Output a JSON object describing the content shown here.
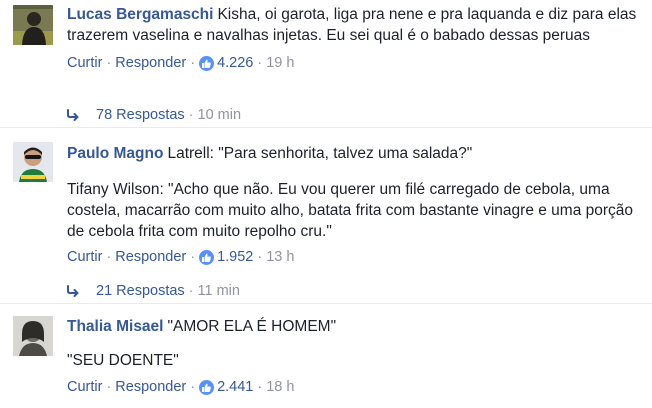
{
  "comments": [
    {
      "author": "Lucas Bergamaschi",
      "paragraphs": [
        "Kisha, oi garota, liga pra nene e pra laquanda e diz para elas trazerem vaselina e navalhas injetas. Eu sei qual é o babado dessas peruas"
      ],
      "like_label": "Curtir",
      "reply_label": "Responder",
      "likes": "4.226",
      "time": "19 h",
      "replies_label": "78 Respostas",
      "replies_time": "10 min"
    },
    {
      "author": "Paulo Magno",
      "paragraphs": [
        "Latrell: \"Para senhorita, talvez uma salada?\"",
        "Tifany Wilson: \"Acho que não. Eu vou querer um filé carregado de cebola, uma costela, macarrão com muito alho, batata frita com bastante vinagre e uma porção de cebola frita com muito repolho cru.\""
      ],
      "like_label": "Curtir",
      "reply_label": "Responder",
      "likes": "1.952",
      "time": "13 h",
      "replies_label": "21 Respostas",
      "replies_time": "11 min"
    },
    {
      "author": "Thalia Misael",
      "paragraphs": [
        "\"AMOR ELA É HOMEM\"",
        "\"SEU DOENTE\""
      ],
      "like_label": "Curtir",
      "reply_label": "Responder",
      "likes": "2.441",
      "time": "18 h"
    }
  ],
  "colors": {
    "link": "#365899",
    "meta": "#90949c",
    "text": "#1d2129",
    "like_badge": "#5890ff",
    "divider": "#e9ebee"
  },
  "icons": {
    "like": "thumbs-up-icon",
    "reply_arrow": "reply-arrow-icon"
  }
}
